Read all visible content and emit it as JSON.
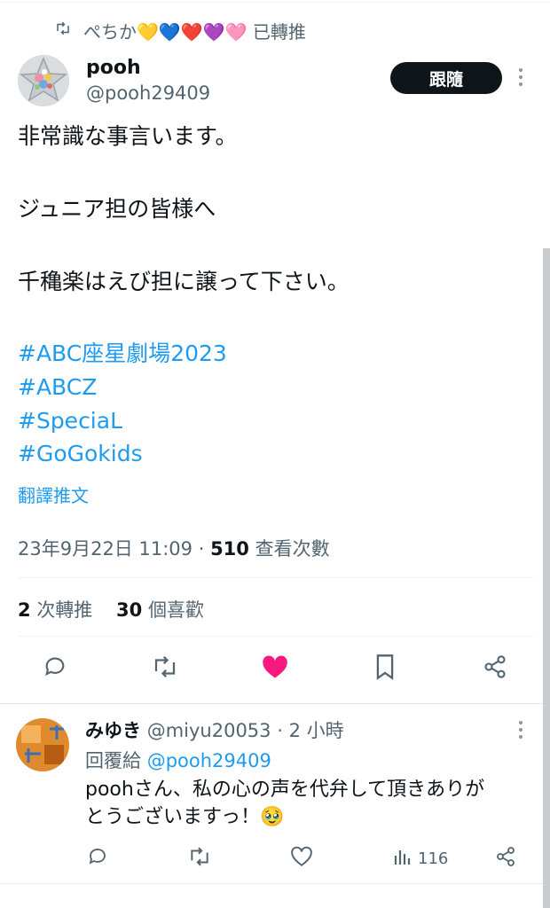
{
  "repost_banner": {
    "user": "ぺちか💛💙❤️💜🩷",
    "label": "已轉推"
  },
  "author": {
    "name": "pooh",
    "handle": "@pooh29409"
  },
  "follow_label": "跟隨",
  "tweet": {
    "line1": "非常識な事言います。",
    "line2": "ジュニア担の皆様へ",
    "line3": "千穐楽はえび担に譲って下さい。",
    "hashtags": [
      "#ABC座星劇場2023",
      "#ABCZ",
      "#SpeciaL",
      "#GoGokids"
    ]
  },
  "translate_label": "翻譯推文",
  "meta": {
    "datetime": "23年9月22日 11:09",
    "separator": "·",
    "views": "510",
    "views_label": "查看次數"
  },
  "stats": {
    "retweets": "2",
    "retweets_label": "次轉推",
    "likes": "30",
    "likes_label": "個喜歡"
  },
  "icons": {
    "retweet_banner": "retweet-icon",
    "reply": "reply-icon",
    "retweet": "retweet-icon",
    "like": "heart-filled-icon",
    "bookmark": "bookmark-icon",
    "share": "share-icon",
    "views": "bar-chart-icon"
  },
  "colors": {
    "accent": "#1d9bf0",
    "like": "#f91880",
    "text": "#0f1419",
    "muted": "#536471"
  },
  "reply": {
    "name": "みゆき",
    "handle": "@miyu20053",
    "separator": "·",
    "time": "2 小時",
    "replying_to_label": "回覆給",
    "replying_to_handle": "@pooh29409",
    "text_line1": "poohさん、私の心の声を代弁して頂きありが",
    "text_line2": "とうございますっ！🥹",
    "views": "116"
  }
}
